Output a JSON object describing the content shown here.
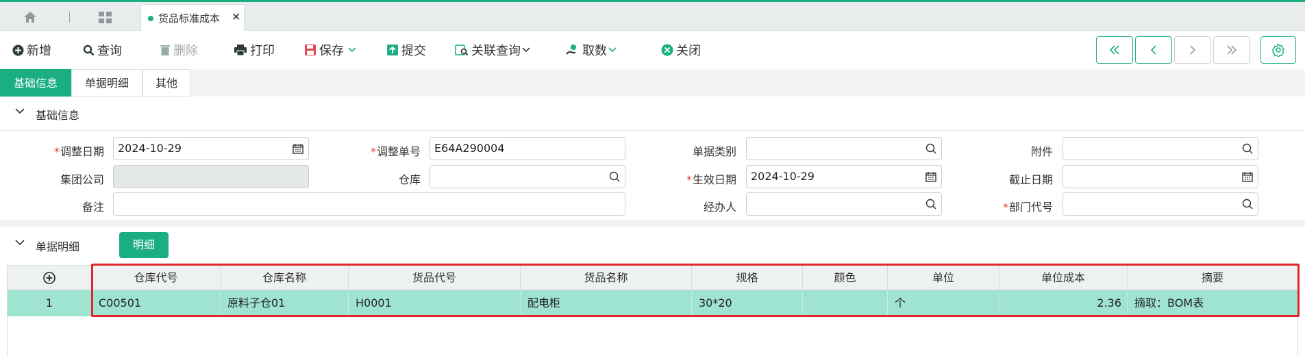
{
  "tabs": {
    "home_icon": "home-icon",
    "apps_icon": "grid-icon",
    "document_tab": "货品标准成本",
    "close_symbol": "✕"
  },
  "toolbar": {
    "add": "新增",
    "query": "查询",
    "delete": "删除",
    "print": "打印",
    "save": "保存",
    "submit": "提交",
    "related_query": "关联查询",
    "fetch": "取数",
    "close": "关闭"
  },
  "subtabs": {
    "basic": "基础信息",
    "detail": "单据明细",
    "other": "其他"
  },
  "basic_section": {
    "title": "基础信息"
  },
  "form": {
    "adjust_date": {
      "label": "调整日期",
      "value": "2024-10-29"
    },
    "adjust_no": {
      "label": "调整单号",
      "value": "E64A290004"
    },
    "doc_type": {
      "label": "单据类别",
      "value": ""
    },
    "attachment": {
      "label": "附件",
      "value": ""
    },
    "group_company": {
      "label": "集团公司",
      "value": ""
    },
    "warehouse": {
      "label": "仓库",
      "value": ""
    },
    "effective_date": {
      "label": "生效日期",
      "value": "2024-10-29"
    },
    "end_date": {
      "label": "截止日期",
      "value": ""
    },
    "remark": {
      "label": "备注",
      "value": ""
    },
    "handler": {
      "label": "经办人",
      "value": ""
    },
    "dept_code": {
      "label": "部门代号",
      "value": ""
    }
  },
  "detail_section": {
    "title": "单据明细",
    "button": "明细"
  },
  "grid": {
    "columns": [
      "仓库代号",
      "仓库名称",
      "货品代号",
      "货品名称",
      "规格",
      "颜色",
      "单位",
      "单位成本",
      "摘要"
    ],
    "rows": [
      {
        "no": "1",
        "cells": [
          "C00501",
          "原料子仓01",
          "H0001",
          "配电柜",
          "30*20",
          "",
          "个",
          "2.36",
          "摘取：BOM表"
        ]
      }
    ]
  },
  "colors": {
    "accent": "#1aae82",
    "row_highlight": "#9fe3d1",
    "required": "#e33333",
    "annotation_box": "#e3262b"
  }
}
